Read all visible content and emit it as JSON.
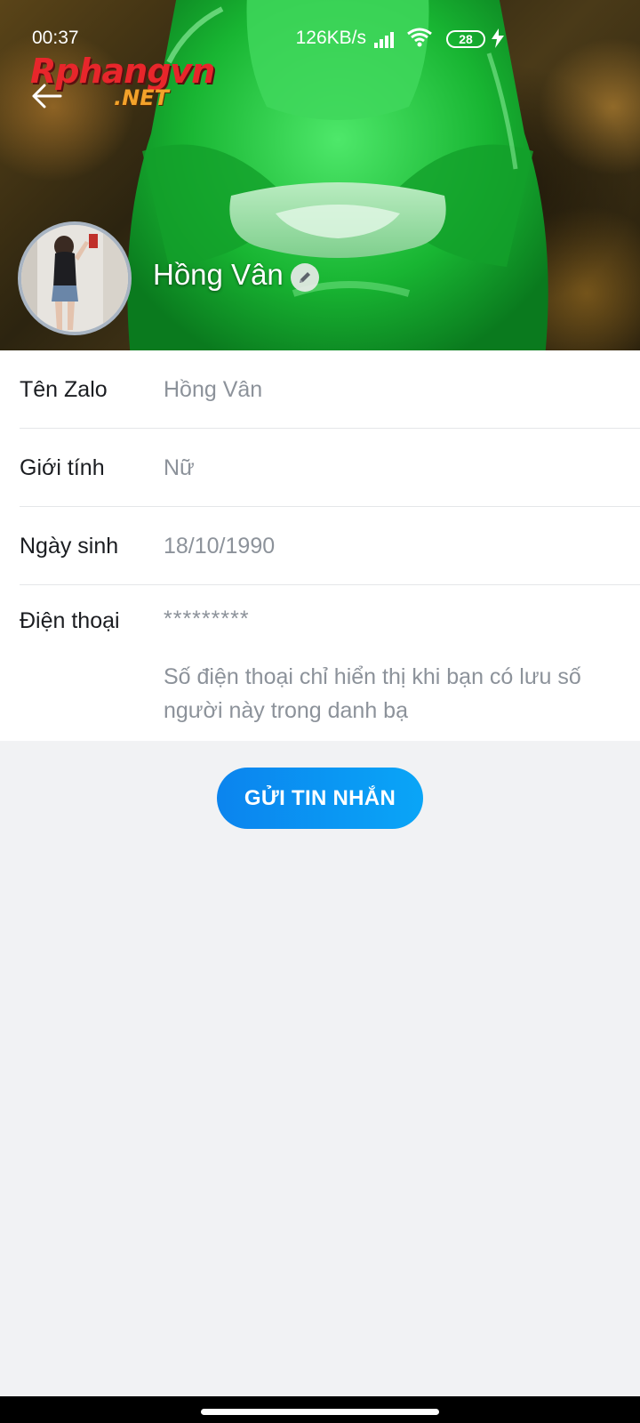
{
  "status_bar": {
    "time": "00:37",
    "network_speed": "126KB/s",
    "battery": "28"
  },
  "watermark": {
    "main": "Rphangvn",
    "sub": ".NET"
  },
  "profile": {
    "name": "Hồng Vân"
  },
  "info": {
    "rows": [
      {
        "label": "Tên Zalo",
        "value": "Hồng Vân"
      },
      {
        "label": "Giới tính",
        "value": "Nữ"
      },
      {
        "label": "Ngày sinh",
        "value": "18/10/1990"
      },
      {
        "label": "Điện thoại",
        "value": "*********",
        "note": "Số điện thoại chỉ hiển thị khi bạn có lưu số người này trong danh bạ"
      }
    ]
  },
  "actions": {
    "send_message": "GỬI TIN NHẮN"
  },
  "icons": {
    "back": "back-arrow-icon",
    "edit": "pencil-icon"
  },
  "colors": {
    "accent": "#0b84ee",
    "cover_green": "#1fc23a",
    "background": "#f1f2f4"
  }
}
